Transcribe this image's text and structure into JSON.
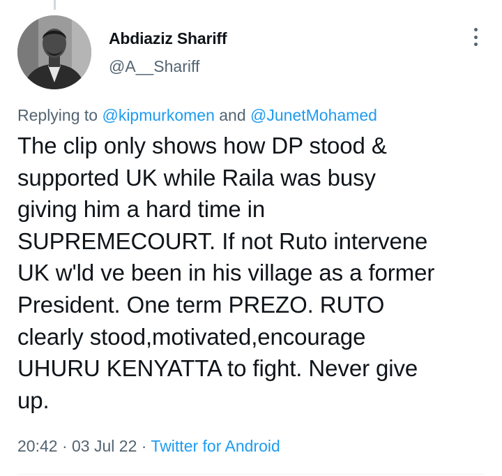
{
  "tweet": {
    "author_name": "Abdiaziz Shariff",
    "author_handle": "@A__Shariff",
    "replying_prefix": "Replying to",
    "reply_to_1": "@kipmurkomen",
    "reply_and": "and",
    "reply_to_2": "@JunetMohamed",
    "text": "The clip only shows how DP stood &\nsupported UK while Raila was busy\ngiving him a hard time in\nSUPREMECOURT. If not Ruto intervene\nUK w'ld ve been in his village as a former\nPresident. One term PREZO. RUTO\nclearly stood,motivated,encourage\nUHURU KENYATTA to fight. Never give\nup.",
    "time": "20:42",
    "separator": "·",
    "date": "03 Jul 22",
    "source": "Twitter for Android"
  },
  "icons": {
    "more": "more-vertical-icon",
    "avatar": "avatar"
  },
  "colors": {
    "link": "#1d9bf0",
    "secondary_text": "#536471",
    "primary_text": "#0f1419"
  }
}
